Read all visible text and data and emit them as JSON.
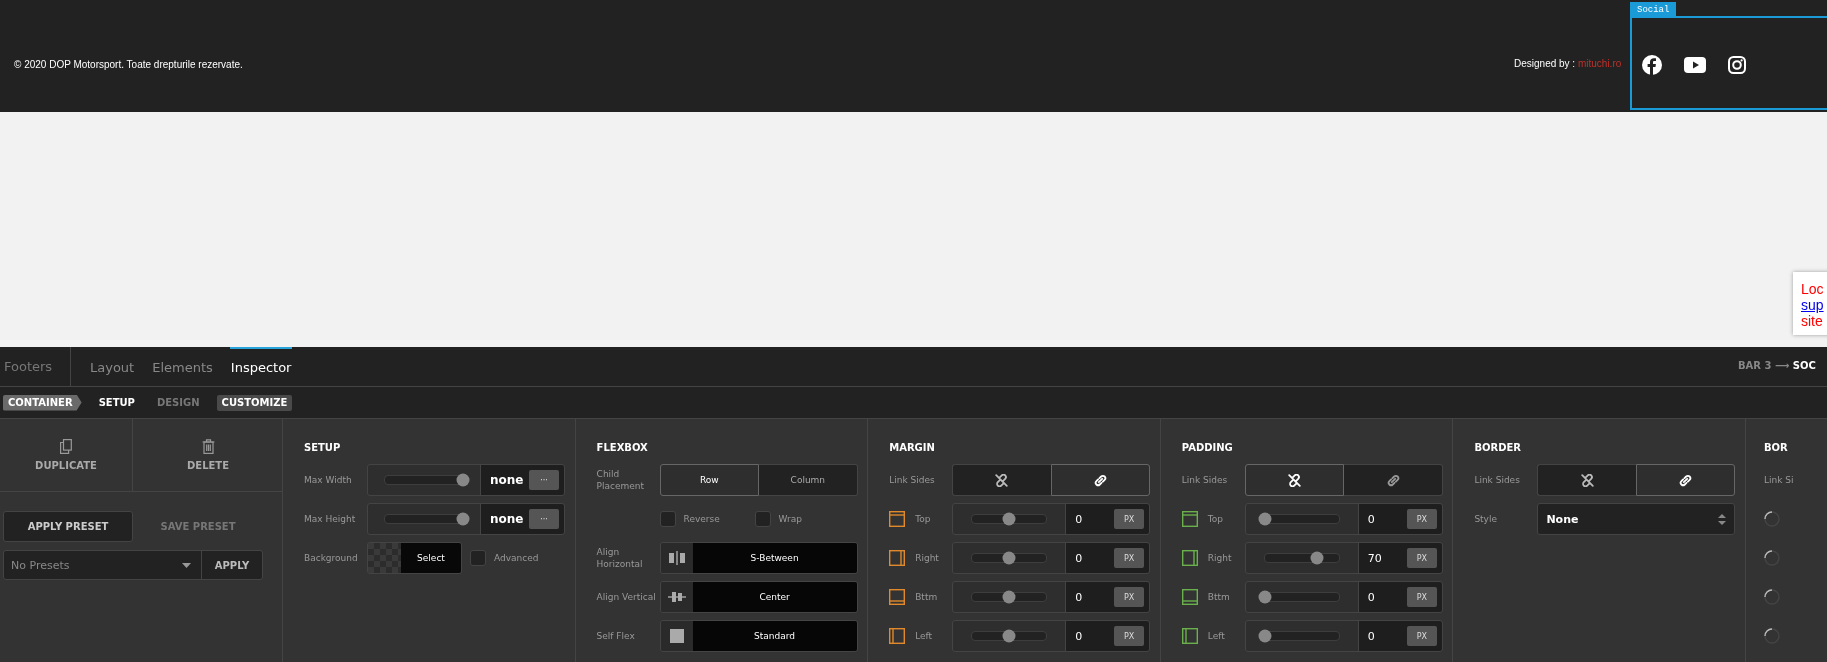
{
  "footer": {
    "copyright": "© 2020 DOP Motorsport. Toate drepturile rezervate.",
    "designed_by": "Designed by :",
    "designer_link": "mituchi.ro",
    "social": {
      "tab": "Social",
      "icons": [
        {
          "kind": "facebook"
        },
        {
          "kind": "youtube"
        },
        {
          "kind": "instagram"
        }
      ]
    }
  },
  "notice": {
    "lines": [
      {
        "text": "Loc",
        "kind": "text"
      },
      {
        "text": "sup",
        "kind": "link"
      },
      {
        "text": "site",
        "kind": "text"
      }
    ]
  },
  "editor": {
    "title": "Footers",
    "tabs": [
      {
        "label": "Layout",
        "selected": false
      },
      {
        "label": "Elements",
        "selected": false
      },
      {
        "label": "Inspector",
        "selected": true
      }
    ],
    "path": {
      "parent": "BAR 3",
      "arrow": "⟶",
      "current": "SOC"
    },
    "steps": [
      {
        "label": "CONTAINER",
        "kind": "crumb"
      },
      {
        "label": "SETUP",
        "kind": "step",
        "disabled": false
      },
      {
        "label": "DESIGN",
        "kind": "step",
        "disabled": true
      },
      {
        "label": "CUSTOMIZE",
        "kind": "pill"
      }
    ],
    "actions": [
      {
        "label": "DUPLICATE",
        "kind": "duplicate"
      },
      {
        "label": "DELETE",
        "kind": "delete"
      }
    ],
    "preset_tabs": [
      {
        "label": "APPLY PRESET",
        "selected": true
      },
      {
        "label": "SAVE PRESET",
        "selected": false
      }
    ],
    "preset_select": {
      "placeholder": "No Presets",
      "button": "APPLY"
    },
    "sections": [
      {
        "kind": "setup",
        "title": "SETUP",
        "rows": [
          {
            "kind": "slider",
            "label": "Max Width",
            "level": 1,
            "value": "none",
            "button": "···"
          },
          {
            "kind": "slider",
            "label": "Max Height",
            "level": 1,
            "value": "none",
            "button": "···"
          },
          {
            "kind": "background",
            "label": "Background",
            "button": "Select",
            "checkbox": {
              "label": "Advanced",
              "checked": false
            }
          }
        ]
      },
      {
        "kind": "flexbox",
        "title": "FLEXBOX",
        "rows": [
          {
            "kind": "segmented",
            "label": "Child Placement",
            "options": [
              {
                "label": "Row",
                "selected": true
              },
              {
                "label": "Column",
                "selected": false
              }
            ]
          },
          {
            "kind": "checks",
            "checks": [
              {
                "label": "Reverse",
                "checked": false
              },
              {
                "label": "Wrap",
                "checked": false
              }
            ]
          },
          {
            "kind": "select",
            "label": "Align Horizontal",
            "value": "S-Between"
          },
          {
            "kind": "select",
            "label": "Align Vertical",
            "value": "Center"
          },
          {
            "kind": "select",
            "label": "Self Flex",
            "value": "Standard"
          }
        ]
      },
      {
        "kind": "spacing",
        "title": "MARGIN",
        "color": "#e08a2c",
        "rows": [
          {
            "kind": "link",
            "label": "Link Sides",
            "options": [
              {
                "kind": "unlink",
                "selected": false
              },
              {
                "kind": "link",
                "selected": true
              }
            ]
          },
          {
            "kind": "top",
            "label": "Top",
            "level": 0.5,
            "value": "0",
            "unit": "PX"
          },
          {
            "kind": "right",
            "label": "Right",
            "level": 0.5,
            "value": "0",
            "unit": "PX"
          },
          {
            "kind": "bottom",
            "label": "Bttm",
            "level": 0.5,
            "value": "0",
            "unit": "PX"
          },
          {
            "kind": "left",
            "label": "Left",
            "level": 0.5,
            "value": "0",
            "unit": "PX"
          }
        ]
      },
      {
        "kind": "spacing",
        "title": "PADDING",
        "color": "#6ab04c",
        "rows": [
          {
            "kind": "link",
            "label": "Link Sides",
            "options": [
              {
                "kind": "unlink",
                "selected": true
              },
              {
                "kind": "link",
                "selected": false
              }
            ]
          },
          {
            "kind": "top",
            "label": "Top",
            "level": 0,
            "value": "0",
            "unit": "PX"
          },
          {
            "kind": "right",
            "label": "Right",
            "level": 0.7,
            "value": "70",
            "unit": "PX"
          },
          {
            "kind": "bottom",
            "label": "Bttm",
            "level": 0,
            "value": "0",
            "unit": "PX"
          },
          {
            "kind": "left",
            "label": "Left",
            "level": 0,
            "value": "0",
            "unit": "PX"
          }
        ]
      },
      {
        "kind": "border",
        "title": "BORDER",
        "rows": [
          {
            "kind": "link",
            "label": "Link Sides",
            "options": [
              {
                "kind": "unlink",
                "selected": false
              },
              {
                "kind": "link",
                "selected": true
              }
            ]
          },
          {
            "kind": "dropdown",
            "label": "Style",
            "value": "None"
          }
        ]
      },
      {
        "kind": "partial",
        "title": "BOR",
        "rows": [
          {
            "kind": "label",
            "label": "Link Si"
          },
          {
            "kind": "spinner"
          },
          {
            "kind": "spinner"
          },
          {
            "kind": "spinner"
          },
          {
            "kind": "spinner"
          }
        ]
      }
    ]
  }
}
